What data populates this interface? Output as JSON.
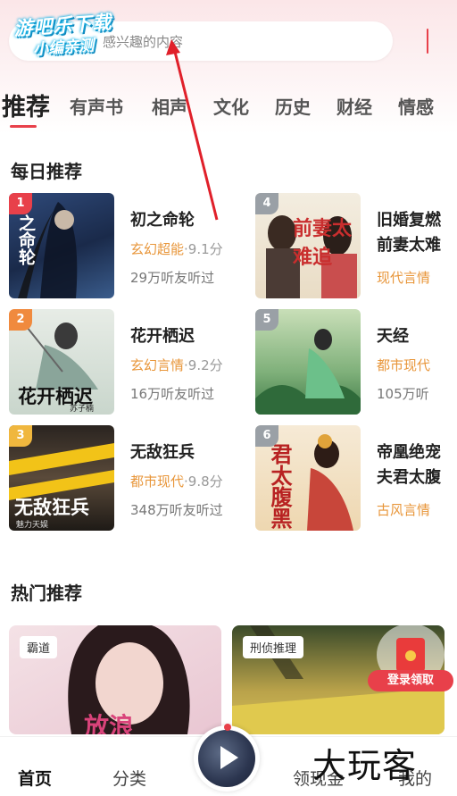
{
  "watermark": {
    "line1": "游吧乐下载",
    "line2": "小编亲测"
  },
  "search": {
    "placeholder": "感兴趣的内容"
  },
  "tabs": [
    {
      "label": "推荐"
    },
    {
      "label": "有声书"
    },
    {
      "label": "相声"
    },
    {
      "label": "文化"
    },
    {
      "label": "历史"
    },
    {
      "label": "财经"
    },
    {
      "label": "情感"
    }
  ],
  "daily": {
    "title": "每日推荐",
    "books": [
      {
        "rank": "1",
        "title": "初之命轮",
        "title2": "",
        "genre": "玄幻超能",
        "score": "·9.1分",
        "listeners": "29万听友听过",
        "cover_text": "之命轮",
        "cover_text2": "初",
        "rank_color": "#e8404a"
      },
      {
        "rank": "4",
        "title": "旧婚复燃",
        "title2": "前妻太难",
        "genre": "现代言情",
        "score": "",
        "listeners": "",
        "cover_text": "前妻太难追",
        "cover_text2": "",
        "rank_color": "#9aa0a6"
      },
      {
        "rank": "2",
        "title": "花开栖迟",
        "title2": "",
        "genre": "玄幻言情",
        "score": "·9.2分",
        "listeners": "16万听友听过",
        "cover_text": "花开栖迟",
        "cover_text2": "苏子楠",
        "rank_color": "#f08a3e"
      },
      {
        "rank": "5",
        "title": "天经",
        "title2": "",
        "genre": "都市现代",
        "score": "",
        "listeners": "105万听",
        "cover_text": "",
        "cover_text2": "",
        "rank_color": "#9aa0a6"
      },
      {
        "rank": "3",
        "title": "无敌狂兵",
        "title2": "",
        "genre": "都市现代",
        "score": "·9.8分",
        "listeners": "348万听友听过",
        "cover_text": "无敌狂兵",
        "cover_text2": "魅力天娱",
        "rank_color": "#f0b73e"
      },
      {
        "rank": "6",
        "title": "帝凰绝宠",
        "title2": "夫君太腹",
        "genre": "古风言情",
        "score": "",
        "listeners": "",
        "cover_text": "君太腹黑",
        "cover_text2": "",
        "rank_color": "#9aa0a6"
      }
    ]
  },
  "hot": {
    "title": "热门推荐",
    "cards": [
      {
        "tag": "霸道",
        "cover_text": "放浪"
      },
      {
        "tag": "刑侦推理"
      }
    ]
  },
  "promo": {
    "label": "登录领取"
  },
  "bottom_nav": [
    {
      "label": "首页"
    },
    {
      "label": "分类"
    },
    {
      "label": "领现金"
    },
    {
      "label": "我的"
    }
  ],
  "corner_watermark": "大玩客",
  "colors": {
    "accent": "#e8404a",
    "genre": "#e8963a"
  }
}
